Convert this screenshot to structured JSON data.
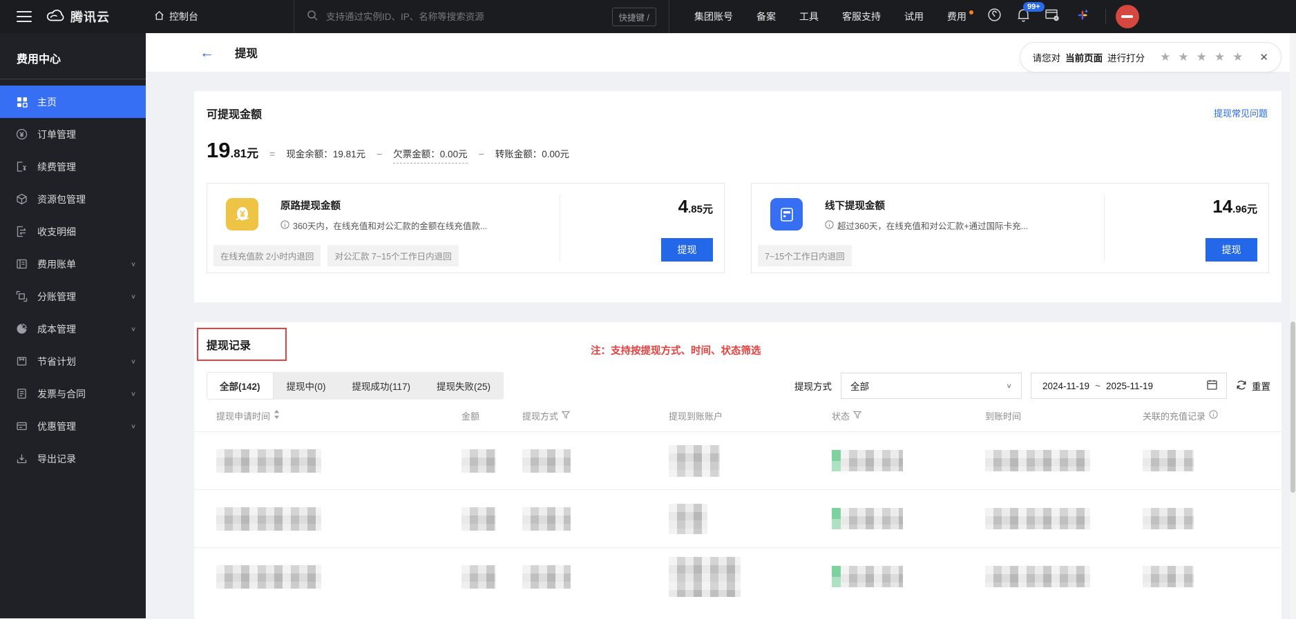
{
  "topbar": {
    "brand": "腾讯云",
    "console_label": "控制台",
    "search_placeholder": "支持通过实例ID、IP、名称等搜索资源",
    "shortcut_label": "快捷键 /",
    "nav": [
      "集团账号",
      "备案",
      "工具",
      "客服支持",
      "试用",
      "费用"
    ],
    "notification_count": "99+"
  },
  "sidebar": {
    "title": "费用中心",
    "items": [
      {
        "label": "主页",
        "icon": "home-grid-icon",
        "active": true
      },
      {
        "label": "订单管理",
        "icon": "order-icon"
      },
      {
        "label": "续费管理",
        "icon": "renew-icon"
      },
      {
        "label": "资源包管理",
        "icon": "package-icon"
      },
      {
        "label": "收支明细",
        "icon": "transactions-icon"
      },
      {
        "label": "费用账单",
        "icon": "bill-icon",
        "expandable": true
      },
      {
        "label": "分账管理",
        "icon": "split-account-icon",
        "expandable": true
      },
      {
        "label": "成本管理",
        "icon": "cost-pie-icon",
        "expandable": true
      },
      {
        "label": "节省计划",
        "icon": "savings-icon",
        "expandable": true
      },
      {
        "label": "发票与合同",
        "icon": "invoice-icon",
        "expandable": true
      },
      {
        "label": "优惠管理",
        "icon": "discount-icon",
        "expandable": true
      },
      {
        "label": "导出记录",
        "icon": "export-icon"
      }
    ]
  },
  "header": {
    "title": "提现"
  },
  "rating": {
    "prefix": "请您对",
    "target": "当前页面",
    "suffix": "进行打分",
    "star_count": 5
  },
  "balance": {
    "section_title": "可提现金额",
    "faq_link": "提现常见问题",
    "amount_int": "19",
    "amount_dec": ".81元",
    "eq": {
      "equals": "=",
      "minus": "−",
      "cash_label": "现金余额：",
      "cash_value": "19.81元",
      "owed_label": "欠票金额：",
      "owed_value": "0.00元",
      "transfer_label": "转账金额：",
      "transfer_value": "0.00元"
    },
    "cards": [
      {
        "title": "原路提现金额",
        "desc": "360天内，在线充值和对公汇款的金额在线充值款...",
        "tags": [
          "在线充值款 2小时内退回",
          "对公汇款 7~15个工作日内退回"
        ],
        "amount_int": "4",
        "amount_dec": ".85元",
        "button": "提现",
        "icon": "coin-icon"
      },
      {
        "title": "线下提现金额",
        "desc": "超过360天，在线充值和对公汇款+通过国际卡充...",
        "tags": [
          "7~15个工作日内退回"
        ],
        "amount_int": "14",
        "amount_dec": ".96元",
        "button": "提现",
        "icon": "bank-card-icon"
      }
    ]
  },
  "records": {
    "section_title": "提现记录",
    "note": "注：支持按提现方式、时间、状态筛选",
    "tabs": [
      {
        "label": "全部(142)",
        "active": true
      },
      {
        "label": "提现中(0)"
      },
      {
        "label": "提现成功(117)"
      },
      {
        "label": "提现失败(25)"
      }
    ],
    "filter": {
      "method_label": "提现方式",
      "method_value": "全部",
      "date_start": "2024-11-19",
      "date_sep": "~",
      "date_end": "2025-11-19",
      "reset_label": "重置"
    },
    "columns": [
      "提现申请时间",
      "金额",
      "提现方式",
      "提现到账账户",
      "状态",
      "到账时间",
      "关联的充值记录"
    ],
    "rows": [
      {
        "redacted": true,
        "status_color": "green"
      },
      {
        "redacted": true,
        "status_color": "green"
      },
      {
        "redacted": true,
        "status_color": "green"
      }
    ]
  },
  "colors": {
    "sidebar_active_blue": "#366ef4",
    "button_blue": "#2268e8",
    "link_blue": "#2468e8",
    "note_red": "#e5413e",
    "badge_blue": "#2a6ae9",
    "dot_orange": "#ff7f1f",
    "status_green": "#7fd1a0",
    "coin_icon_yellow": "#efc343"
  }
}
